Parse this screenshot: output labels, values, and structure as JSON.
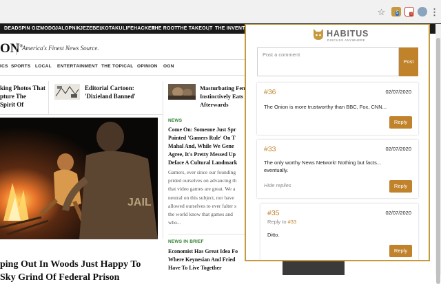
{
  "browser": {
    "icons": [
      "star-icon",
      "habitus-extension-icon",
      "calendar-extension-icon",
      "profile-avatar",
      "kebab-menu-icon"
    ],
    "badges": {
      "extension_one": "5",
      "extension_two": "1"
    }
  },
  "network_bar": {
    "items": [
      "DEADSPIN",
      "GIZMODO",
      "JALOPNIK",
      "JEZEBEL",
      "KOTAKU",
      "LIFEHACKER",
      "THE ROOT",
      "THE TAKEOUT",
      "THE INVENTORY"
    ]
  },
  "site": {
    "logo": "ON",
    "tagline": "America's Finest News Source.",
    "sections": [
      "ICS",
      "SPORTS",
      "LOCAL",
      "ENTERTAINMENT",
      "THE TOPICAL",
      "OPINION",
      "OGN"
    ]
  },
  "teasers": [
    {
      "title_line1": "king Photos That",
      "title_line2": "pture The",
      "title_line3": "Spirit Of"
    },
    {
      "title_line1": "Editorial Cartoon:",
      "title_line2": "'Dixieland Banned'"
    },
    {
      "title_line1": "Masturbating Fem",
      "title_line2": "Instinctively Eats",
      "title_line3": "Afterwards"
    }
  ],
  "hero": {
    "image_text": "JAIL",
    "headline_line1": "ping Out In Woods Just Happy To",
    "headline_line2": "Sky Grind Of Federal Prison"
  },
  "articles": [
    {
      "kicker": "NEWS",
      "title_lines": [
        "Come On: Someone Just Spr",
        "Painted 'Gamers Rule' On T",
        "Mahal And, While We Gene",
        "Agree, It's Pretty Messed Up",
        "Deface A Cultural Landmark"
      ],
      "excerpt_lines": [
        "Gamers, ever since our founding",
        "prided ourselves on advancing th",
        "that video games are great. We a",
        "neutral on this subject, nor have",
        "allowed ourselves to ever falter s",
        "the world know that games and",
        "who..."
      ]
    },
    {
      "kicker": "NEWS IN BRIEF",
      "title_lines": [
        "Economist Has Great Idea Fo",
        "Where Keynesian And Fried",
        "Have To Live Together"
      ]
    }
  ],
  "popup": {
    "brand_name": "HABITUS",
    "brand_tagline": "DISCUSS ANYWHERE",
    "comment_placeholder": "Post a comment",
    "post_label": "Post",
    "reply_label": "Reply",
    "hide_replies_label": "Hide replies",
    "reply_to_prefix": "Reply to",
    "comments": [
      {
        "id": "#36",
        "date": "02/07/2020",
        "text": "The Onion is more trustworthy than BBC, Fox, CNN..."
      },
      {
        "id": "#33",
        "date": "02/07/2020",
        "text_line1": "The only worthy News Network! Nothing but facts...",
        "text_line2": "eventually."
      },
      {
        "id": "#35",
        "date": "02/07/2020",
        "reply_to": "#33",
        "text": "Ditto."
      }
    ]
  },
  "colors": {
    "accent": "#c0822b",
    "border": "#c59a3f",
    "kicker": "#2d7d2d",
    "network_bar": "#1a1a1a"
  }
}
